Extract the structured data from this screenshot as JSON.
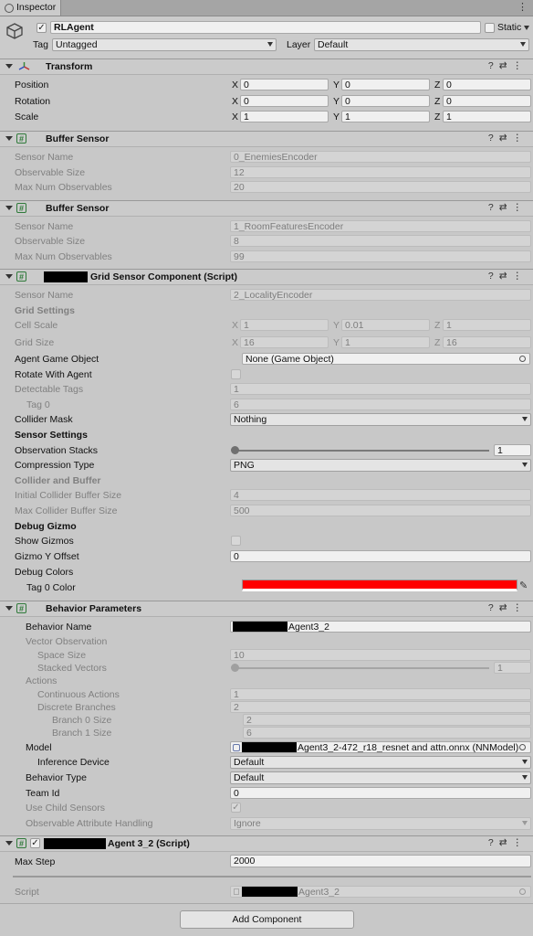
{
  "window": {
    "tab_label": "Inspector",
    "menu_icon": "kebab-icon"
  },
  "object": {
    "name": "RLAgent",
    "active": true,
    "static_label": "Static",
    "tag_label": "Tag",
    "tag_value": "Untagged",
    "layer_label": "Layer",
    "layer_value": "Default"
  },
  "transform": {
    "title": "Transform",
    "position_label": "Position",
    "position": {
      "x": "0",
      "y": "0",
      "z": "0"
    },
    "rotation_label": "Rotation",
    "rotation": {
      "x": "0",
      "y": "0",
      "z": "0"
    },
    "scale_label": "Scale",
    "scale": {
      "x": "1",
      "y": "1",
      "z": "1"
    }
  },
  "axes": {
    "x": "X",
    "y": "Y",
    "z": "Z"
  },
  "buffer1": {
    "title": "Buffer Sensor",
    "sensor_name_label": "Sensor Name",
    "sensor_name": "0_EnemiesEncoder",
    "obs_size_label": "Observable Size",
    "obs_size": "12",
    "max_num_label": "Max Num Observables",
    "max_num": "20"
  },
  "buffer2": {
    "title": "Buffer Sensor",
    "sensor_name_label": "Sensor Name",
    "sensor_name": "1_RoomFeaturesEncoder",
    "obs_size_label": "Observable Size",
    "obs_size": "8",
    "max_num_label": "Max Num Observables",
    "max_num": "99"
  },
  "grid": {
    "title": "Grid Sensor Component (Script)",
    "sensor_name_label": "Sensor Name",
    "sensor_name": "2_LocalityEncoder",
    "grid_settings": "Grid Settings",
    "cell_scale_label": "Cell Scale",
    "cell_scale": {
      "x": "1",
      "y": "0.01",
      "z": "1"
    },
    "grid_size_label": "Grid Size",
    "grid_size": {
      "x": "16",
      "y": "1",
      "z": "16"
    },
    "agent_go_label": "Agent Game Object",
    "agent_go": "None (Game Object)",
    "rotate_label": "Rotate With Agent",
    "detectable_label": "Detectable Tags",
    "detectable": "1",
    "tag0_label": "Tag 0",
    "tag0": "6",
    "collider_mask_label": "Collider Mask",
    "collider_mask": "Nothing",
    "sensor_settings": "Sensor Settings",
    "obs_stacks_label": "Observation Stacks",
    "obs_stacks": "1",
    "obs_stacks_fraction": 0,
    "compression_label": "Compression Type",
    "compression": "PNG",
    "collider_buffer": "Collider and Buffer",
    "init_buffer_label": "Initial Collider Buffer Size",
    "init_buffer": "4",
    "max_buffer_label": "Max Collider Buffer Size",
    "max_buffer": "500",
    "debug_gizmo": "Debug Gizmo",
    "show_gizmos_label": "Show Gizmos",
    "gizmo_offset_label": "Gizmo Y Offset",
    "gizmo_offset": "0",
    "debug_colors_label": "Debug Colors",
    "tag0_color_label": "Tag 0 Color",
    "tag0_color": "#ff0000"
  },
  "behavior": {
    "title": "Behavior Parameters",
    "name_label": "Behavior Name",
    "name_suffix": "Agent3_2",
    "vector_obs_label": "Vector Observation",
    "space_size_label": "Space Size",
    "space_size": "10",
    "stacked_label": "Stacked Vectors",
    "stacked": "1",
    "stacked_fraction": 0,
    "actions_label": "Actions",
    "cont_label": "Continuous Actions",
    "cont": "1",
    "disc_label": "Discrete Branches",
    "disc": "2",
    "b0_label": "Branch 0 Size",
    "b0": "2",
    "b1_label": "Branch 1 Size",
    "b1": "6",
    "model_label": "Model",
    "model": "Agent3_2-472_r18_resnet and attn.onnx (NNModel)",
    "device_label": "Inference Device",
    "device": "Default",
    "type_label": "Behavior Type",
    "type": "Default",
    "team_label": "Team Id",
    "team": "0",
    "child_label": "Use Child Sensors",
    "attr_label": "Observable Attribute Handling",
    "attr": "Ignore"
  },
  "agent": {
    "title": "Agent 3_2 (Script)",
    "max_step_label": "Max Step",
    "max_step": "2000",
    "script_label": "Script",
    "script": "Agent3_2"
  },
  "add_component": "Add Component"
}
